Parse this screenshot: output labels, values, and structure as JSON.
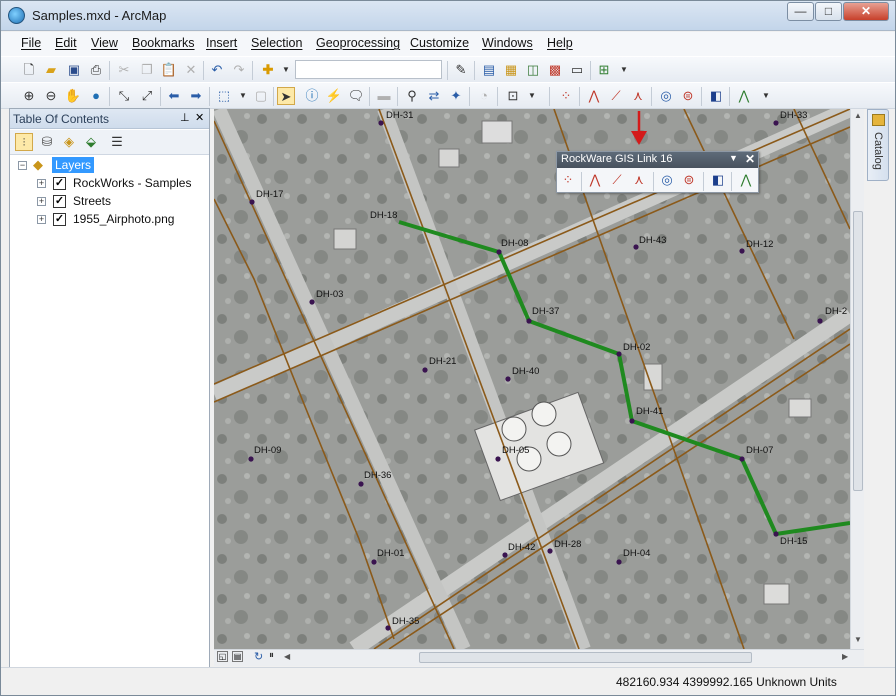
{
  "window": {
    "title": "Samples.mxd - ArcMap",
    "minimize": "—",
    "maximize": "□",
    "close": "✕"
  },
  "menu": [
    "File",
    "Edit",
    "View",
    "Bookmarks",
    "Insert",
    "Selection",
    "Geoprocessing",
    "Customize",
    "Windows",
    "Help"
  ],
  "toc": {
    "title": "Table Of Contents",
    "pin": "⊥",
    "close": "✕",
    "root_label": "Layers",
    "layers": [
      {
        "label": "RockWorks - Samples",
        "checked": true
      },
      {
        "label": "Streets",
        "checked": true
      },
      {
        "label": "1955_Airphoto.png",
        "checked": true
      }
    ]
  },
  "floating_toolbar": {
    "title": "RockWare GIS Link 16",
    "menu_arrow": "▼",
    "close": "✕"
  },
  "catalog_tab": {
    "label": "Catalog"
  },
  "map": {
    "labels": [
      "DH-31",
      "DH-33",
      "DH-17",
      "DH-18",
      "DH-08",
      "DH-43",
      "DH-12",
      "DH-03",
      "DH-37",
      "DH-2",
      "DH-21",
      "DH-40",
      "DH-02",
      "DH-41",
      "DH-09",
      "DH-05",
      "DH-07",
      "DH-36",
      "DH-15",
      "DH-01",
      "DH-42",
      "DH-28",
      "DH-04",
      "DH-35"
    ],
    "route_color": "#1f8a1f",
    "street_color": "#8b5a1a",
    "point_color": "#3a1450"
  },
  "status": {
    "coordinates": "482160.934  4399992.165 Unknown Units"
  },
  "icons": {
    "toolbar1": [
      "new-file-icon",
      "open-folder-icon",
      "save-icon",
      "print-icon",
      "cut-icon",
      "copy-icon",
      "paste-icon",
      "delete-icon",
      "undo-icon",
      "redo-icon",
      "add-data-icon",
      "scale-combo",
      "editor-icon",
      "table-icon",
      "arccatalog-icon",
      "arctoolbox-icon",
      "python-icon",
      "model-icon"
    ],
    "toolbar2": [
      "zoom-in-icon",
      "zoom-out-icon",
      "pan-icon",
      "full-extent-icon",
      "fixed-zoom-in-icon",
      "fixed-zoom-out-icon",
      "back-icon",
      "forward-icon",
      "select-features-icon",
      "clear-selection-icon",
      "select-elements-icon",
      "identify-icon",
      "hyperlink-icon",
      "html-popup-icon",
      "measure-icon",
      "find-icon",
      "goto-xy-icon",
      "time-slider-icon",
      "create-viewer-icon",
      "rockware-icons"
    ]
  }
}
